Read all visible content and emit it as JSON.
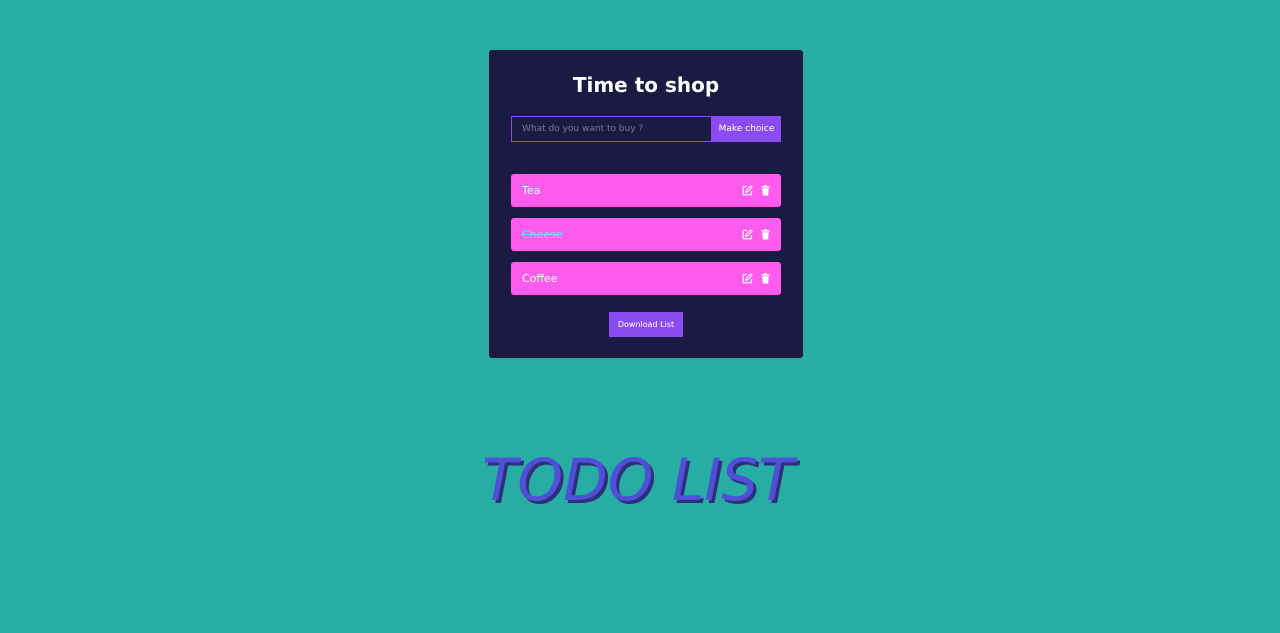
{
  "app": {
    "title": "Time to shop"
  },
  "form": {
    "placeholder": "What do you want to buy ?",
    "value": "",
    "submit_label": "Make choice"
  },
  "items": [
    {
      "label": "Tea",
      "done": false
    },
    {
      "label": "Cheese",
      "done": true
    },
    {
      "label": "Coffee",
      "done": false
    }
  ],
  "download_label": "Download List",
  "banner": {
    "text": "TODO LIST"
  },
  "icons": {
    "edit": "edit-icon",
    "delete": "trash-icon"
  },
  "colors": {
    "background": "#27ada4",
    "card": "#1b1a42",
    "accent": "#8a4cf0",
    "item": "#ff5ced",
    "banner": "#4f4fd8"
  }
}
